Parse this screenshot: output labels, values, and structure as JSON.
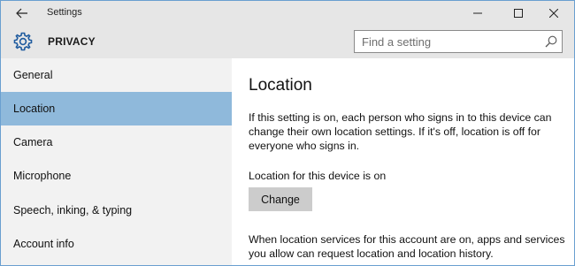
{
  "window": {
    "title": "Settings",
    "back_icon": "back-arrow-icon",
    "minimize_icon": "minimize-icon",
    "maximize_icon": "maximize-icon",
    "close_icon": "close-icon"
  },
  "header": {
    "icon": "gear-icon",
    "title": "PRIVACY",
    "search_placeholder": "Find a setting",
    "search_icon": "search-icon"
  },
  "sidebar": {
    "items": [
      {
        "label": "General",
        "selected": false
      },
      {
        "label": "Location",
        "selected": true
      },
      {
        "label": "Camera",
        "selected": false
      },
      {
        "label": "Microphone",
        "selected": false
      },
      {
        "label": "Speech, inking, & typing",
        "selected": false
      },
      {
        "label": "Account info",
        "selected": false
      }
    ]
  },
  "main": {
    "title": "Location",
    "intro": "If this setting is on, each person who signs in to this device can change their own location settings. If it's off, location is off for everyone who signs in.",
    "device_status": "Location for this device is on",
    "change_label": "Change",
    "services_text": "When location services for this account are on, apps and services you allow can request location and location history."
  },
  "colors": {
    "selected_nav": "#8fb9db",
    "titlebar": "#e6e6e6",
    "sidebar": "#f2f2f2",
    "button": "#cccccc",
    "accent": "#1e5a9e"
  }
}
